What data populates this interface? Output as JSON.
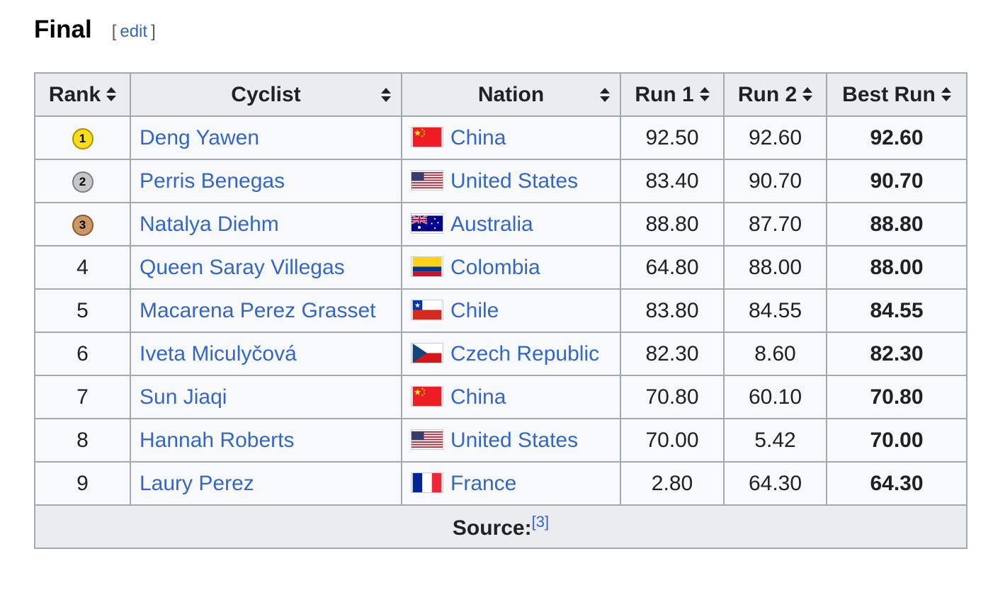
{
  "heading": {
    "title": "Final",
    "edit_open": "[",
    "edit_label": "edit",
    "edit_close": "]"
  },
  "columns": [
    "Rank",
    "Cyclist",
    "Nation",
    "Run 1",
    "Run 2",
    "Best Run"
  ],
  "rows": [
    {
      "rank": "1",
      "medal": "gold",
      "cyclist": "Deng Yawen",
      "flag": "china-flag-icon",
      "nation": "China",
      "run1": "92.50",
      "run2": "92.60",
      "best": "92.60"
    },
    {
      "rank": "2",
      "medal": "silver",
      "cyclist": "Perris Benegas",
      "flag": "usa-flag-icon",
      "nation": "United States",
      "run1": "83.40",
      "run2": "90.70",
      "best": "90.70"
    },
    {
      "rank": "3",
      "medal": "bronze",
      "cyclist": "Natalya Diehm",
      "flag": "australia-flag-icon",
      "nation": "Australia",
      "run1": "88.80",
      "run2": "87.70",
      "best": "88.80"
    },
    {
      "rank": "4",
      "medal": "",
      "cyclist": "Queen Saray Villegas",
      "flag": "colombia-flag-icon",
      "nation": "Colombia",
      "run1": "64.80",
      "run2": "88.00",
      "best": "88.00"
    },
    {
      "rank": "5",
      "medal": "",
      "cyclist": "Macarena Perez Grasset",
      "flag": "chile-flag-icon",
      "nation": "Chile",
      "run1": "83.80",
      "run2": "84.55",
      "best": "84.55"
    },
    {
      "rank": "6",
      "medal": "",
      "cyclist": "Iveta Miculyčová",
      "flag": "czech-flag-icon",
      "nation": "Czech Republic",
      "run1": "82.30",
      "run2": "8.60",
      "best": "82.30"
    },
    {
      "rank": "7",
      "medal": "",
      "cyclist": "Sun Jiaqi",
      "flag": "china-flag-icon",
      "nation": "China",
      "run1": "70.80",
      "run2": "60.10",
      "best": "70.80"
    },
    {
      "rank": "8",
      "medal": "",
      "cyclist": "Hannah Roberts",
      "flag": "usa-flag-icon",
      "nation": "United States",
      "run1": "70.00",
      "run2": "5.42",
      "best": "70.00"
    },
    {
      "rank": "9",
      "medal": "",
      "cyclist": "Laury Perez",
      "flag": "france-flag-icon",
      "nation": "France",
      "run1": "2.80",
      "run2": "64.30",
      "best": "64.30"
    }
  ],
  "footer": {
    "label": "Source:",
    "ref": "[3]"
  },
  "colors": {
    "link": "#3366cc",
    "header_bg": "#eaecf0",
    "border": "#a2a9b1",
    "gold": "#f9dd1d",
    "silver": "#c7c7c7",
    "bronze": "#cc9966"
  }
}
